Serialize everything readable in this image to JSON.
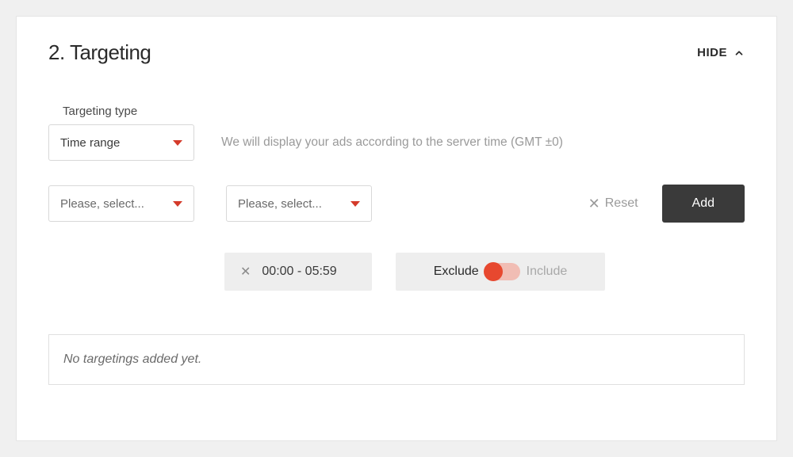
{
  "section": {
    "title": "2. Targeting",
    "hide_label": "HIDE"
  },
  "targeting_type": {
    "label": "Targeting type",
    "value": "Time range",
    "hint": "We will display your ads according to the server time (GMT ±0)"
  },
  "selects": {
    "from_placeholder": "Please, select...",
    "to_placeholder": "Please, select..."
  },
  "actions": {
    "reset_label": "Reset",
    "add_label": "Add"
  },
  "chip": {
    "time_range": "00:00 - 05:59"
  },
  "toggle": {
    "exclude_label": "Exclude",
    "include_label": "Include",
    "state": "exclude"
  },
  "empty_message": "No targetings added yet."
}
